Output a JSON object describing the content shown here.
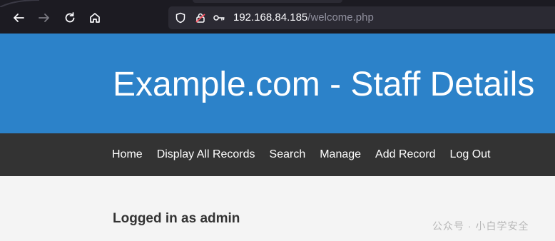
{
  "browser": {
    "url_host": "192.168.84.185",
    "url_path": "/welcome.php",
    "icons": [
      "back-arrow-icon",
      "forward-arrow-icon",
      "reload-icon",
      "home-icon",
      "shield-icon",
      "insecure-lock-icon",
      "key-icon"
    ]
  },
  "header": {
    "title": "Example.com - Staff Details"
  },
  "nav": {
    "items": [
      "Home",
      "Display All Records",
      "Search",
      "Manage",
      "Add Record",
      "Log Out"
    ]
  },
  "content": {
    "logged_in_text": "Logged in as admin"
  },
  "watermark": {
    "text": "公众号 · 小白学安全"
  },
  "colors": {
    "header_bg": "#2c82c9",
    "nav_bg": "#333333",
    "content_bg": "#f4f4f4",
    "toolbar_bg": "#1c1b22"
  }
}
